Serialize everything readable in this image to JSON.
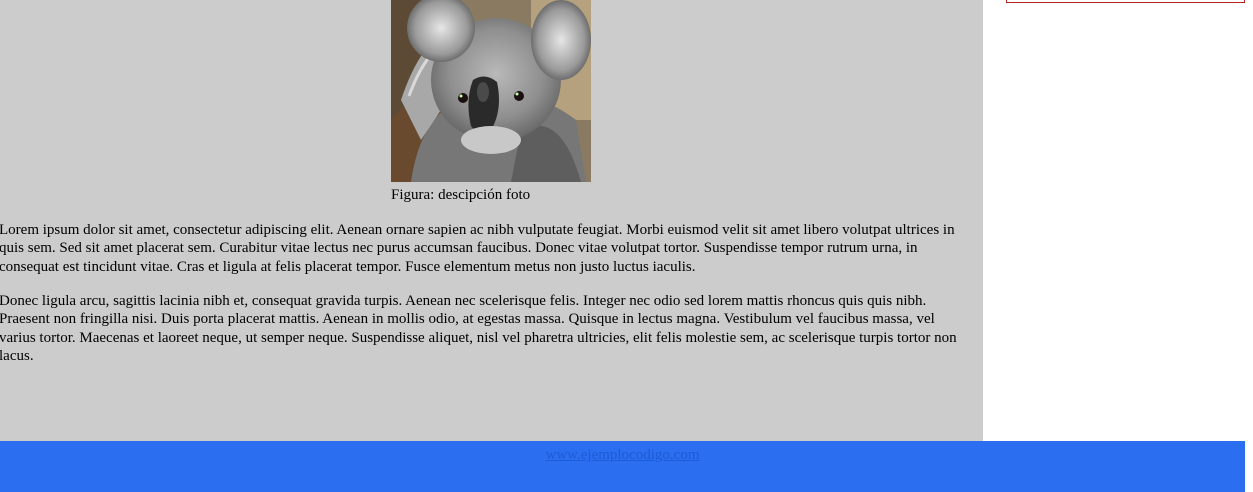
{
  "figure": {
    "caption": "Figura: descipción foto",
    "image_subject": "koala-photo"
  },
  "content": {
    "paragraphs": [
      "Lorem ipsum dolor sit amet, consectetur adipiscing elit. Aenean ornare sapien ac nibh vulputate feugiat. Morbi euismod velit sit amet libero volutpat ultrices in quis sem. Sed sit amet placerat sem. Curabitur vitae lectus nec purus accumsan faucibus. Donec vitae volutpat tortor. Suspendisse tempor rutrum urna, in consequat est tincidunt vitae. Cras et ligula at felis placerat tempor. Fusce elementum metus non justo luctus iaculis.",
      "Donec ligula arcu, sagittis lacinia nibh et, consequat gravida turpis. Aenean nec scelerisque felis. Integer nec odio sed lorem mattis rhoncus quis quis nibh. Praesent non fringilla nisi. Duis porta placerat mattis. Aenean in mollis odio, at egestas massa. Quisque in lectus magna. Vestibulum vel faucibus massa, vel varius tortor. Maecenas et laoreet neque, ut semper neque. Suspendisse aliquet, nisl vel pharetra ultricies, elit felis molestie sem, ac scelerisque turpis tortor non lacus."
    ]
  },
  "footer": {
    "link_text": "www.ejemplocodigo.com"
  },
  "colors": {
    "main_background": "#cccccc",
    "footer_background": "#2b6ef0",
    "link": "#1e5bd6",
    "sidebar_border": "#b22222"
  }
}
